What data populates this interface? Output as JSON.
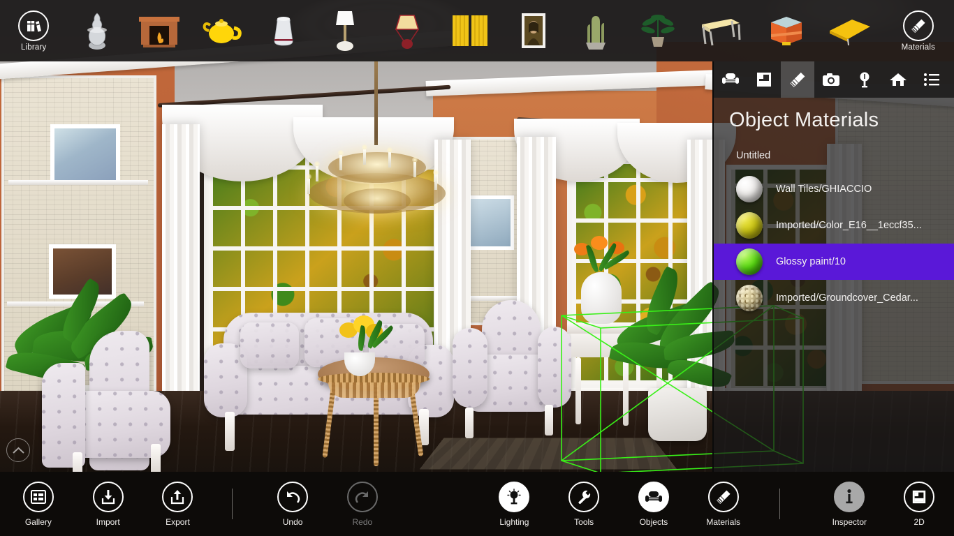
{
  "app": {
    "title": "Live Interior 3D",
    "accent_selected": "#5a18d8",
    "selection_wire_color": "#39f018"
  },
  "top_toolbar": {
    "library_label": "Library",
    "library_icon": "books-library-icon",
    "materials_label": "Materials",
    "materials_icon": "paintbrush-icon",
    "objects": [
      {
        "name": "silver-vase-object",
        "label": "Silver Vase"
      },
      {
        "name": "fireplace-object",
        "label": "Fireplace"
      },
      {
        "name": "yellow-teapot-object",
        "label": "Yellow Teapot"
      },
      {
        "name": "white-jug-object",
        "label": "White Jug"
      },
      {
        "name": "floor-lamp-object",
        "label": "Floor Lamp"
      },
      {
        "name": "table-lamp-object",
        "label": "Table Lamp"
      },
      {
        "name": "yellow-curtains-object",
        "label": "Yellow Curtains"
      },
      {
        "name": "mona-lisa-painting-object",
        "label": "Framed Painting"
      },
      {
        "name": "cactus-plant-object",
        "label": "Cactus"
      },
      {
        "name": "potted-plant-object",
        "label": "Potted Plant"
      },
      {
        "name": "white-desk-object",
        "label": "Desk"
      },
      {
        "name": "orange-side-table-object",
        "label": "Side Table"
      },
      {
        "name": "yellow-table-object",
        "label": "Yellow Table"
      }
    ]
  },
  "right_panel": {
    "title": "Object Materials",
    "subtitle": "Untitled",
    "tabs": [
      {
        "name": "tab-objects",
        "icon": "armchair-icon",
        "active": false
      },
      {
        "name": "tab-floorplan",
        "icon": "floorplan-icon",
        "active": false
      },
      {
        "name": "tab-materials",
        "icon": "paintbrush-icon",
        "active": true
      },
      {
        "name": "tab-camera",
        "icon": "camera-icon",
        "active": false
      },
      {
        "name": "tab-lighting",
        "icon": "lightbulb-icon",
        "active": false
      },
      {
        "name": "tab-home",
        "icon": "home-icon",
        "active": false
      },
      {
        "name": "tab-list",
        "icon": "list-icon",
        "active": false
      }
    ],
    "materials": [
      {
        "label": "Wall Tiles/GHIACCIO",
        "color": "#f2f0ee",
        "selected": false
      },
      {
        "label": "Imported/Color_E16__1eccf35...",
        "color": "#cbc513",
        "selected": false
      },
      {
        "label": "Glossy paint/10",
        "color": "#59dd12",
        "selected": true
      },
      {
        "label": "Imported/Groundcover_Cedar...",
        "color": "#cbbf92",
        "selected": false
      }
    ]
  },
  "viewport": {
    "collapse_icon": "chevron-up-icon"
  },
  "bottom_toolbar": {
    "items": [
      {
        "name": "gallery-button",
        "label": "Gallery",
        "icon": "gallery-grid-icon",
        "style": "outline",
        "disabled": false
      },
      {
        "name": "import-button",
        "label": "Import",
        "icon": "import-down-arrow-icon",
        "style": "outline",
        "disabled": false
      },
      {
        "name": "export-button",
        "label": "Export",
        "icon": "export-up-arrow-icon",
        "style": "outline",
        "disabled": false
      },
      {
        "name": "separator-1",
        "label": "",
        "icon": "separator",
        "style": "separator",
        "disabled": false
      },
      {
        "name": "undo-button",
        "label": "Undo",
        "icon": "undo-arrow-icon",
        "style": "outline",
        "disabled": false
      },
      {
        "name": "redo-button",
        "label": "Redo",
        "icon": "redo-arrow-icon",
        "style": "outline",
        "disabled": true
      },
      {
        "name": "lighting-button",
        "label": "Lighting",
        "icon": "lightbulb-icon",
        "style": "filled",
        "disabled": false
      },
      {
        "name": "tools-button",
        "label": "Tools",
        "icon": "wrench-icon",
        "style": "outline",
        "disabled": false
      },
      {
        "name": "objects-button",
        "label": "Objects",
        "icon": "armchair-icon",
        "style": "filled",
        "disabled": false
      },
      {
        "name": "materials-button",
        "label": "Materials",
        "icon": "paintbrush-icon",
        "style": "outline",
        "disabled": false
      },
      {
        "name": "separator-2",
        "label": "",
        "icon": "separator",
        "style": "separator",
        "disabled": false
      },
      {
        "name": "inspector-button",
        "label": "Inspector",
        "icon": "info-icon",
        "style": "grey",
        "disabled": false
      },
      {
        "name": "two-d-button",
        "label": "2D",
        "icon": "floorplan-icon",
        "style": "outline",
        "disabled": false
      }
    ]
  }
}
